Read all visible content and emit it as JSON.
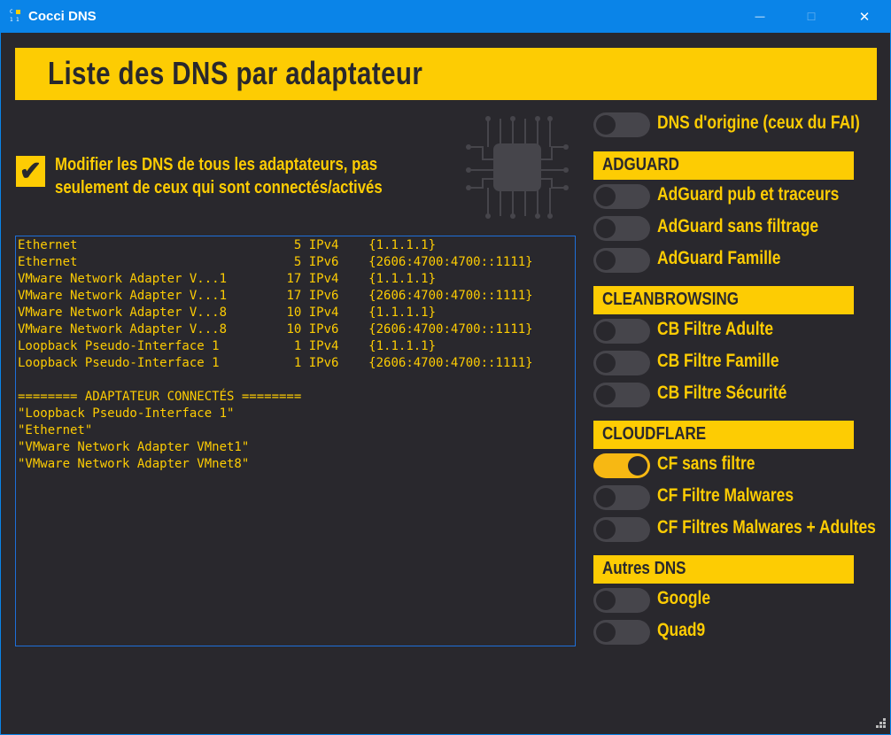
{
  "window": {
    "title": "Cocci DNS",
    "minimize_glyph": "—",
    "maximize_glyph": "☐",
    "close_glyph": "✕",
    "icon_text": [
      "C",
      "1",
      "1"
    ]
  },
  "header": {
    "title": "Liste des DNS par adaptateur"
  },
  "option": {
    "checked": true,
    "check_glyph": "✔",
    "label": "Modifier les DNS de tous les adaptateurs, pas seulement de ceux qui sont connectés/activés"
  },
  "console": {
    "rows": [
      {
        "adapter": "Ethernet",
        "index": "5",
        "family": "IPv4",
        "dns": "{1.1.1.1}"
      },
      {
        "adapter": "Ethernet",
        "index": "5",
        "family": "IPv6",
        "dns": "{2606:4700:4700::1111}"
      },
      {
        "adapter": "VMware Network Adapter V...1",
        "index": "17",
        "family": "IPv4",
        "dns": "{1.1.1.1}"
      },
      {
        "adapter": "VMware Network Adapter V...1",
        "index": "17",
        "family": "IPv6",
        "dns": "{2606:4700:4700::1111}"
      },
      {
        "adapter": "VMware Network Adapter V...8",
        "index": "10",
        "family": "IPv4",
        "dns": "{1.1.1.1}"
      },
      {
        "adapter": "VMware Network Adapter V...8",
        "index": "10",
        "family": "IPv6",
        "dns": "{2606:4700:4700::1111}"
      },
      {
        "adapter": "Loopback Pseudo-Interface 1",
        "index": "1",
        "family": "IPv4",
        "dns": "{1.1.1.1}"
      },
      {
        "adapter": "Loopback Pseudo-Interface 1",
        "index": "1",
        "family": "IPv6",
        "dns": "{2606:4700:4700::1111}"
      }
    ],
    "connected_header": "======== ADAPTATEUR CONNECTÉS ========",
    "connected": [
      "\"Loopback Pseudo-Interface 1\"",
      "\"Ethernet\"",
      "\"VMware Network Adapter VMnet1\"",
      "\"VMware Network Adapter VMnet8\""
    ]
  },
  "sidebar": {
    "original": {
      "label": "DNS d'origine (ceux du FAI)",
      "on": false
    },
    "sections": [
      {
        "title": "ADGUARD",
        "items": [
          {
            "label": "AdGuard pub et traceurs",
            "on": false
          },
          {
            "label": "AdGuard sans filtrage",
            "on": false
          },
          {
            "label": "AdGuard Famille",
            "on": false
          }
        ]
      },
      {
        "title": "CLEANBROWSING",
        "items": [
          {
            "label": "CB Filtre Adulte",
            "on": false
          },
          {
            "label": "CB Filtre Famille",
            "on": false
          },
          {
            "label": "CB Filtre Sécurité",
            "on": false
          }
        ]
      },
      {
        "title": "CLOUDFLARE",
        "items": [
          {
            "label": "CF sans filtre",
            "on": true
          },
          {
            "label": "CF Filtre Malwares",
            "on": false
          },
          {
            "label": "CF Filtres Malwares + Adultes",
            "on": false
          }
        ]
      },
      {
        "title": "Autres DNS",
        "items": [
          {
            "label": "Google",
            "on": false
          },
          {
            "label": "Quad9",
            "on": false
          }
        ]
      }
    ]
  },
  "colors": {
    "accent": "#fdcc03",
    "toggle_on": "#f7b813",
    "toggle_off": "#46454b",
    "background": "#29282d",
    "titlebar": "#0a84e8"
  }
}
